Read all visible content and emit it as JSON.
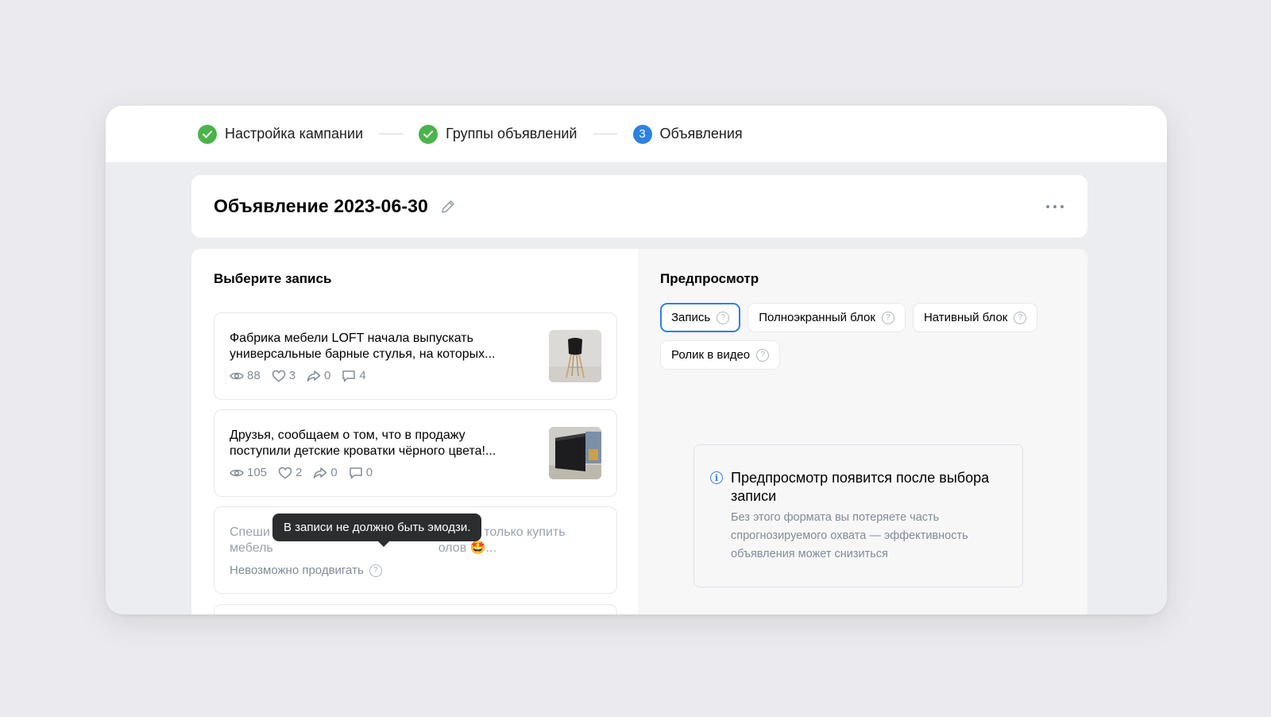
{
  "stepper": {
    "steps": [
      {
        "label": "Настройка кампании",
        "state": "done"
      },
      {
        "label": "Группы объявлений",
        "state": "done"
      },
      {
        "label": "Объявления",
        "state": "current",
        "number": "3"
      }
    ]
  },
  "ad": {
    "title": "Объявление 2023-06-30"
  },
  "posts": {
    "section_title": "Выберите запись",
    "items": [
      {
        "text": "Фабрика мебели LOFT начала выпускать универсальные барные стулья, на которых...",
        "views": "88",
        "likes": "3",
        "shares": "0",
        "comments": "4"
      },
      {
        "text": "Друзья, сообщаем о том, что в продажу поступили детские кроватки чёрного цвета!...",
        "views": "105",
        "likes": "2",
        "shares": "0",
        "comments": "0"
      },
      {
        "text": "Спеши                е только купить мебель             олов 🤩...",
        "status": "Невозможно продвигать",
        "tooltip": "В записи не должно быть эмодзи."
      }
    ]
  },
  "preview": {
    "title": "Предпросмотр",
    "tabs": [
      "Запись",
      "Полноэкранный блок",
      "Нативный блок",
      "Ролик в видео"
    ],
    "active_tab": "Запись",
    "info_title": "Предпросмотр появится после выбора записи",
    "info_desc": "Без этого формата вы потеряете часть спрогнозируемого охвата — эффективность объявления может снизиться"
  },
  "colors": {
    "accent": "#2d81e0",
    "success": "#4bb34b",
    "secondary_text": "#818c99"
  }
}
